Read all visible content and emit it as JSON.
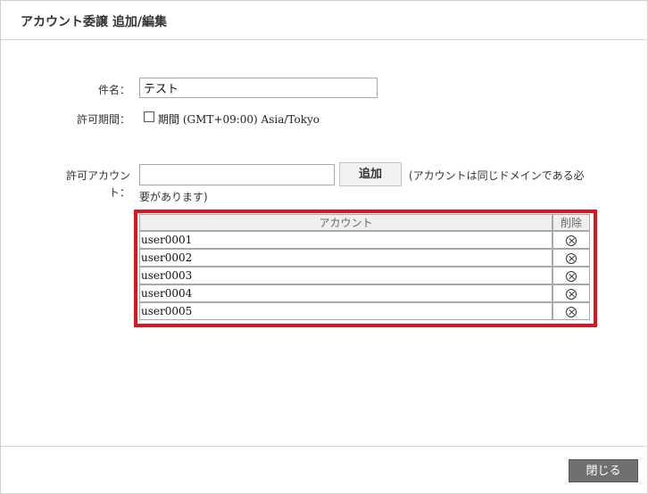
{
  "dialog": {
    "title": "アカウント委譲 追加/編集"
  },
  "form": {
    "subject_label": "件名：",
    "subject_value": "テスト",
    "period_label": "許可期間：",
    "period_checkbox_label": "期間",
    "period_timezone": "(GMT+09:00) Asia/Tokyo",
    "period_checked": false,
    "account_label_line1": "許可アカウン",
    "account_label_line2": "ト：",
    "account_input_value": "",
    "add_button_label": "追加",
    "hint_line1": "(アカウントは同じドメインである必",
    "hint_line2": "要があります)"
  },
  "accounts_table": {
    "headers": {
      "account": "アカウント",
      "delete": "削除"
    },
    "rows": [
      {
        "account": "user0001"
      },
      {
        "account": "user0002"
      },
      {
        "account": "user0003"
      },
      {
        "account": "user0004"
      },
      {
        "account": "user0005"
      }
    ]
  },
  "footer": {
    "close_button_label": "閉じる"
  },
  "icons": {
    "delete": "circle-x-icon",
    "checkbox": "checkbox-unchecked-icon"
  },
  "colors": {
    "highlight_border": "#e0141e",
    "close_button_bg": "#707070"
  }
}
